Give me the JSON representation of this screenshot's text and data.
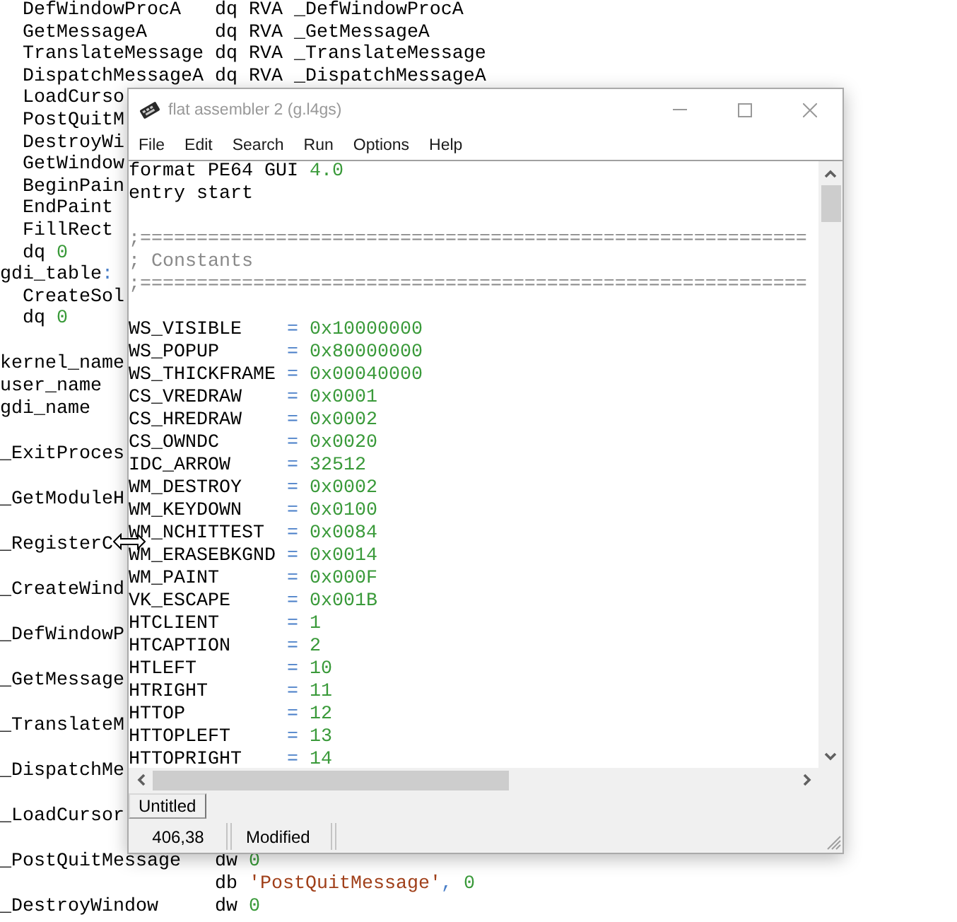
{
  "background_editor": {
    "blocks": [
      [
        {
          "kind": "indented",
          "tokens": [
            {
              "text": "DefWindowProcA   dq RVA _DefWindowProcA",
              "kind": "plain"
            }
          ]
        },
        {
          "kind": "indented",
          "tokens": [
            {
              "text": "GetMessageA      dq RVA _GetMessageA",
              "kind": "plain"
            }
          ]
        },
        {
          "kind": "indented",
          "tokens": [
            {
              "text": "TranslateMessage dq RVA _TranslateMessage",
              "kind": "plain"
            }
          ]
        },
        {
          "kind": "indented",
          "tokens": [
            {
              "text": "DispatchMessageA dq RVA _DispatchMessageA",
              "kind": "plain"
            }
          ]
        },
        {
          "kind": "indented",
          "tokens": [
            {
              "text": "LoadCurso",
              "kind": "plain"
            }
          ]
        },
        {
          "kind": "indented",
          "tokens": [
            {
              "text": "PostQuitM",
              "kind": "plain"
            }
          ]
        },
        {
          "kind": "indented",
          "tokens": [
            {
              "text": "DestroyWi",
              "kind": "plain"
            }
          ]
        },
        {
          "kind": "indented",
          "tokens": [
            {
              "text": "GetWindow",
              "kind": "plain"
            }
          ]
        },
        {
          "kind": "indented",
          "tokens": [
            {
              "text": "BeginPain",
              "kind": "plain"
            }
          ]
        },
        {
          "kind": "indented",
          "tokens": [
            {
              "text": "EndPaint",
              "kind": "plain"
            }
          ]
        },
        {
          "kind": "indented",
          "tokens": [
            {
              "text": "FillRect",
              "kind": "plain"
            }
          ]
        },
        {
          "kind": "indented",
          "tokens": [
            {
              "text": "dq ",
              "kind": "plain"
            },
            {
              "text": "0",
              "kind": "number"
            }
          ]
        },
        {
          "kind": "flush",
          "tokens": [
            {
              "text": "gdi_table",
              "kind": "plain"
            },
            {
              "text": ":",
              "kind": "operator"
            }
          ]
        },
        {
          "kind": "indented",
          "tokens": [
            {
              "text": "CreateSol",
              "kind": "plain"
            }
          ]
        },
        {
          "kind": "indented",
          "tokens": [
            {
              "text": "dq ",
              "kind": "plain"
            },
            {
              "text": "0",
              "kind": "number"
            }
          ]
        }
      ],
      [
        {
          "kind": "flush",
          "tokens": [
            {
              "text": "kernel_name",
              "kind": "plain"
            }
          ]
        },
        {
          "kind": "flush",
          "tokens": [
            {
              "text": "user_name",
              "kind": "plain"
            }
          ]
        },
        {
          "kind": "flush",
          "tokens": [
            {
              "text": "gdi_name",
              "kind": "plain"
            }
          ]
        }
      ],
      [
        {
          "kind": "flush",
          "tokens": [
            {
              "text": "_ExitProces",
              "kind": "plain"
            }
          ]
        }
      ],
      [
        {
          "kind": "flush",
          "tokens": [
            {
              "text": "_GetModuleH",
              "kind": "plain"
            }
          ]
        }
      ],
      [
        {
          "kind": "flush",
          "tokens": [
            {
              "text": "_RegisterC",
              "kind": "plain"
            }
          ]
        }
      ],
      [
        {
          "kind": "flush",
          "tokens": [
            {
              "text": "_CreateWind",
              "kind": "plain"
            }
          ]
        }
      ],
      [
        {
          "kind": "flush",
          "tokens": [
            {
              "text": "_DefWindowP",
              "kind": "plain"
            }
          ]
        }
      ],
      [
        {
          "kind": "flush",
          "tokens": [
            {
              "text": "_GetMessage",
              "kind": "plain"
            }
          ]
        }
      ],
      [
        {
          "kind": "flush",
          "tokens": [
            {
              "text": "_TranslateM",
              "kind": "plain"
            }
          ]
        }
      ],
      [
        {
          "kind": "flush",
          "tokens": [
            {
              "text": "_DispatchMe",
              "kind": "plain"
            }
          ]
        }
      ],
      [
        {
          "kind": "flush",
          "tokens": [
            {
              "text": "_LoadCursor",
              "kind": "plain"
            }
          ]
        }
      ],
      [
        {
          "kind": "flush",
          "tokens": [
            {
              "text": "_PostQuitMessage   dw ",
              "kind": "plain"
            },
            {
              "text": "0",
              "kind": "number"
            }
          ]
        },
        {
          "kind": "continuation",
          "tokens": [
            {
              "text": "db ",
              "kind": "plain"
            },
            {
              "text": "'PostQuitMessage'",
              "kind": "string"
            },
            {
              "text": ",",
              "kind": "operator"
            },
            {
              "text": " 0",
              "kind": "number"
            }
          ]
        },
        {
          "kind": "flush",
          "tokens": [
            {
              "text": "_DestroyWindow     dw ",
              "kind": "plain"
            },
            {
              "text": "0",
              "kind": "number"
            }
          ]
        }
      ]
    ]
  },
  "window": {
    "title": "flat assembler 2 (g.l4gs)",
    "active": false,
    "menu": [
      "File",
      "Edit",
      "Search",
      "Run",
      "Options",
      "Help"
    ],
    "editor": {
      "blocks": [
        [
          {
            "kind": "flush",
            "tokens": [
              {
                "text": "format PE64 GUI ",
                "kind": "plain"
              },
              {
                "text": "4.0",
                "kind": "number"
              }
            ]
          },
          {
            "kind": "flush",
            "tokens": [
              {
                "text": "entry start",
                "kind": "plain"
              }
            ]
          }
        ],
        [
          {
            "kind": "flush",
            "tokens": [
              {
                "text": ";===========================================================",
                "kind": "comment"
              }
            ]
          },
          {
            "kind": "flush",
            "tokens": [
              {
                "text": "; Constants",
                "kind": "comment"
              }
            ]
          },
          {
            "kind": "flush",
            "tokens": [
              {
                "text": ";===========================================================",
                "kind": "comment"
              }
            ]
          }
        ],
        [
          {
            "kind": "flush",
            "tokens": [
              {
                "text": "WS_VISIBLE    ",
                "kind": "plain"
              },
              {
                "text": "=",
                "kind": "operator"
              },
              {
                "text": " 0x10000000",
                "kind": "number"
              }
            ]
          },
          {
            "kind": "flush",
            "tokens": [
              {
                "text": "WS_POPUP      ",
                "kind": "plain"
              },
              {
                "text": "=",
                "kind": "operator"
              },
              {
                "text": " 0x80000000",
                "kind": "number"
              }
            ]
          },
          {
            "kind": "flush",
            "tokens": [
              {
                "text": "WS_THICKFRAME ",
                "kind": "plain"
              },
              {
                "text": "=",
                "kind": "operator"
              },
              {
                "text": " 0x00040000",
                "kind": "number"
              }
            ]
          },
          {
            "kind": "flush",
            "tokens": [
              {
                "text": "CS_VREDRAW    ",
                "kind": "plain"
              },
              {
                "text": "=",
                "kind": "operator"
              },
              {
                "text": " 0x0001",
                "kind": "number"
              }
            ]
          },
          {
            "kind": "flush",
            "tokens": [
              {
                "text": "CS_HREDRAW    ",
                "kind": "plain"
              },
              {
                "text": "=",
                "kind": "operator"
              },
              {
                "text": " 0x0002",
                "kind": "number"
              }
            ]
          },
          {
            "kind": "flush",
            "tokens": [
              {
                "text": "CS_OWNDC      ",
                "kind": "plain"
              },
              {
                "text": "=",
                "kind": "operator"
              },
              {
                "text": " 0x0020",
                "kind": "number"
              }
            ]
          },
          {
            "kind": "flush",
            "tokens": [
              {
                "text": "IDC_ARROW     ",
                "kind": "plain"
              },
              {
                "text": "=",
                "kind": "operator"
              },
              {
                "text": " 32512",
                "kind": "number"
              }
            ]
          },
          {
            "kind": "flush",
            "tokens": [
              {
                "text": "WM_DESTROY    ",
                "kind": "plain"
              },
              {
                "text": "=",
                "kind": "operator"
              },
              {
                "text": " 0x0002",
                "kind": "number"
              }
            ]
          },
          {
            "kind": "flush",
            "tokens": [
              {
                "text": "WM_KEYDOWN    ",
                "kind": "plain"
              },
              {
                "text": "=",
                "kind": "operator"
              },
              {
                "text": " 0x0100",
                "kind": "number"
              }
            ]
          },
          {
            "kind": "flush",
            "tokens": [
              {
                "text": "WM_NCHITTEST  ",
                "kind": "plain"
              },
              {
                "text": "=",
                "kind": "operator"
              },
              {
                "text": " 0x0084",
                "kind": "number"
              }
            ]
          },
          {
            "kind": "flush",
            "tokens": [
              {
                "text": "WM_ERASEBKGND ",
                "kind": "plain"
              },
              {
                "text": "=",
                "kind": "operator"
              },
              {
                "text": " 0x0014",
                "kind": "number"
              }
            ]
          },
          {
            "kind": "flush",
            "tokens": [
              {
                "text": "WM_PAINT      ",
                "kind": "plain"
              },
              {
                "text": "=",
                "kind": "operator"
              },
              {
                "text": " 0x000F",
                "kind": "number"
              }
            ]
          },
          {
            "kind": "flush",
            "tokens": [
              {
                "text": "VK_ESCAPE     ",
                "kind": "plain"
              },
              {
                "text": "=",
                "kind": "operator"
              },
              {
                "text": " 0x001B",
                "kind": "number"
              }
            ]
          },
          {
            "kind": "flush",
            "tokens": [
              {
                "text": "HTCLIENT      ",
                "kind": "plain"
              },
              {
                "text": "=",
                "kind": "operator"
              },
              {
                "text": " 1",
                "kind": "number"
              }
            ]
          },
          {
            "kind": "flush",
            "tokens": [
              {
                "text": "HTCAPTION     ",
                "kind": "plain"
              },
              {
                "text": "=",
                "kind": "operator"
              },
              {
                "text": " 2",
                "kind": "number"
              }
            ]
          },
          {
            "kind": "flush",
            "tokens": [
              {
                "text": "HTLEFT        ",
                "kind": "plain"
              },
              {
                "text": "=",
                "kind": "operator"
              },
              {
                "text": " 10",
                "kind": "number"
              }
            ]
          },
          {
            "kind": "flush",
            "tokens": [
              {
                "text": "HTRIGHT       ",
                "kind": "plain"
              },
              {
                "text": "=",
                "kind": "operator"
              },
              {
                "text": " 11",
                "kind": "number"
              }
            ]
          },
          {
            "kind": "flush",
            "tokens": [
              {
                "text": "HTTOP         ",
                "kind": "plain"
              },
              {
                "text": "=",
                "kind": "operator"
              },
              {
                "text": " 12",
                "kind": "number"
              }
            ]
          },
          {
            "kind": "flush",
            "tokens": [
              {
                "text": "HTTOPLEFT     ",
                "kind": "plain"
              },
              {
                "text": "=",
                "kind": "operator"
              },
              {
                "text": " 13",
                "kind": "number"
              }
            ]
          },
          {
            "kind": "flush",
            "tokens": [
              {
                "text": "HTTOPRIGHT    ",
                "kind": "plain"
              },
              {
                "text": "=",
                "kind": "operator"
              },
              {
                "text": " 14",
                "kind": "number"
              }
            ]
          }
        ]
      ]
    },
    "tabs": [
      {
        "label": "Untitled",
        "selected": true
      }
    ],
    "status_bar": [
      "406,38",
      "Modified"
    ]
  }
}
